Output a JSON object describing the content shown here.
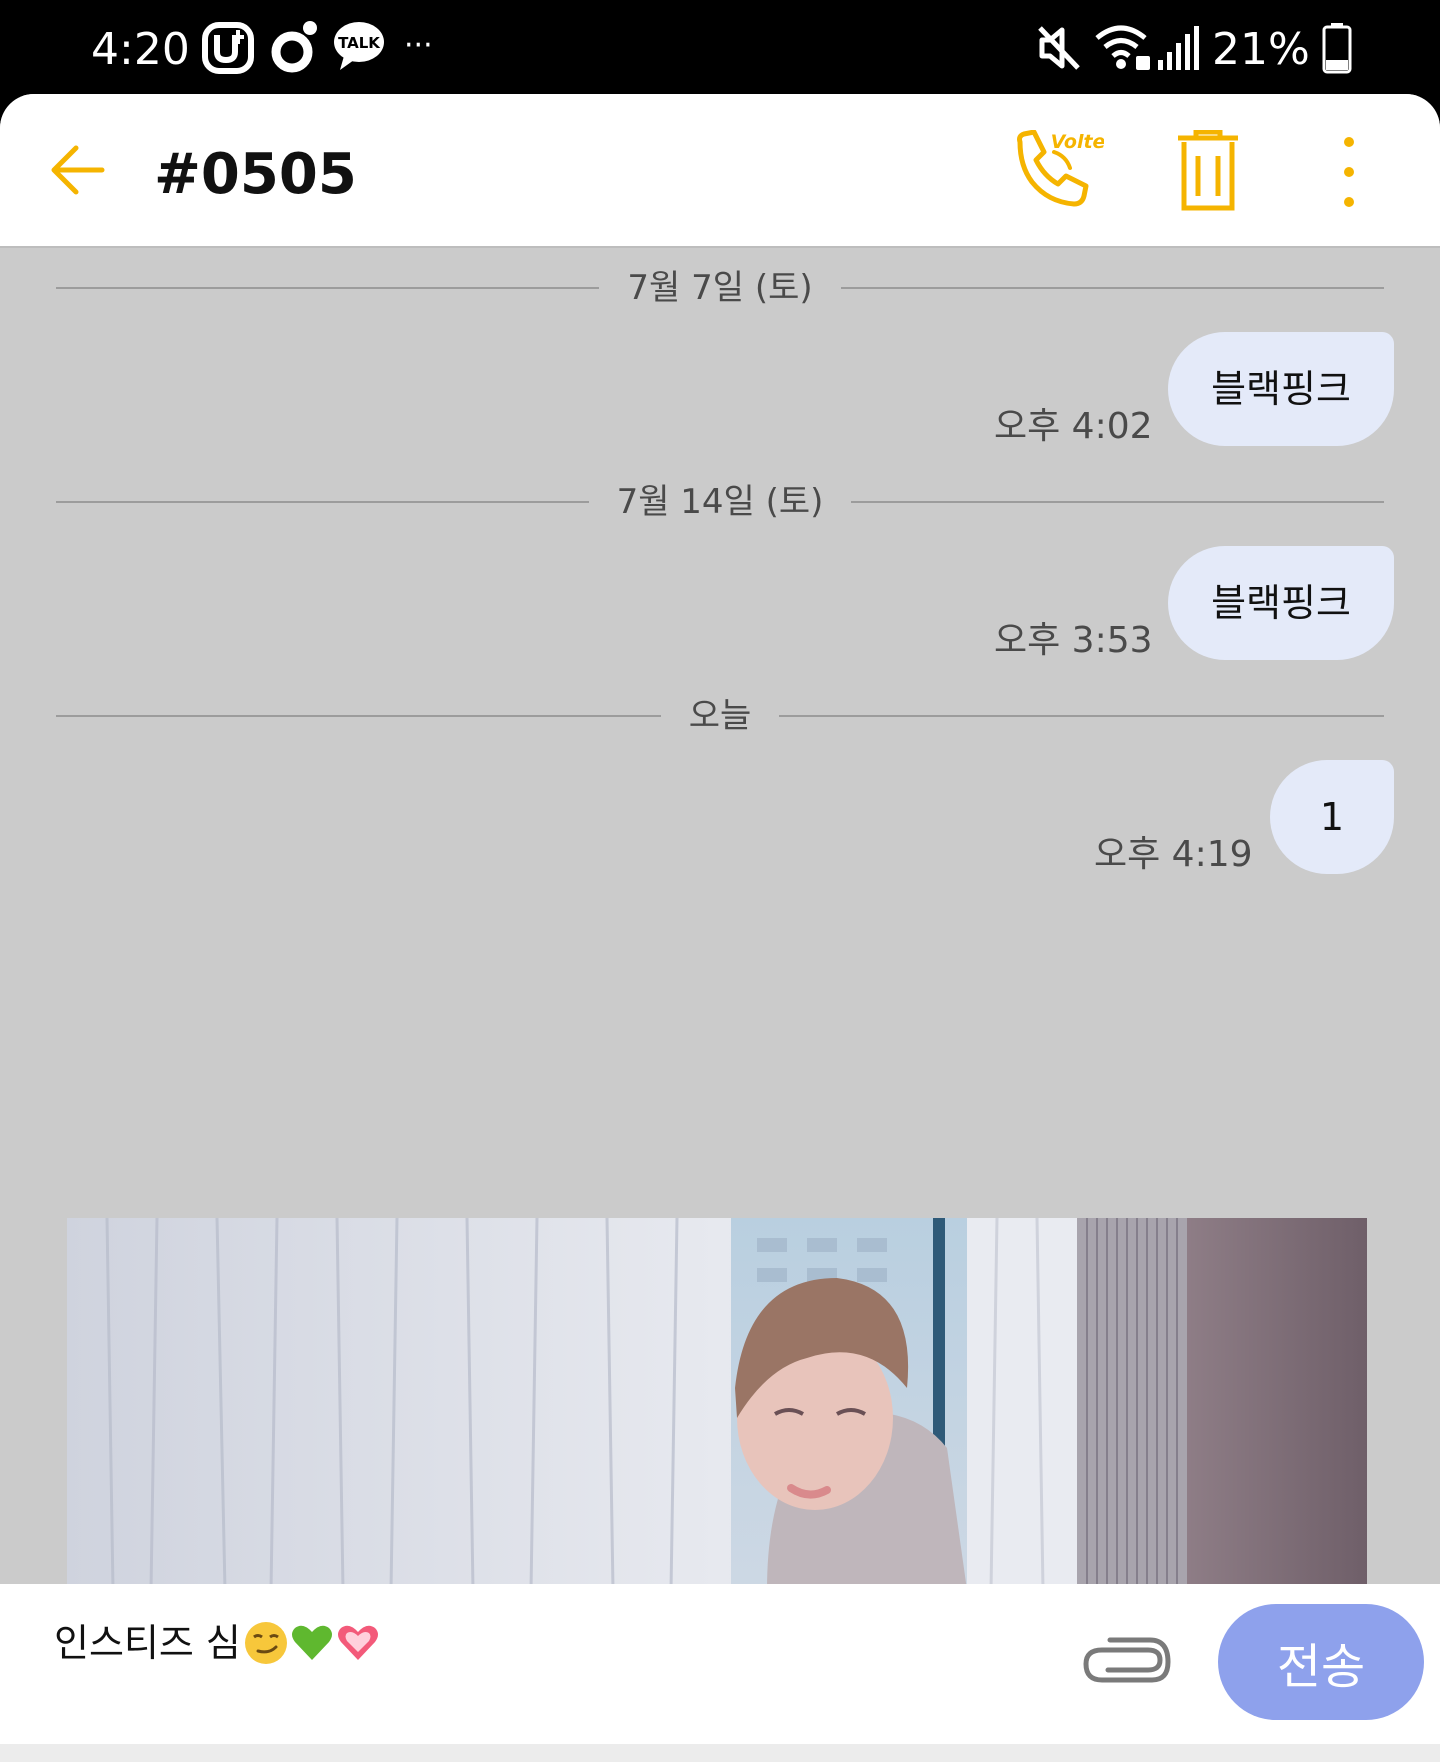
{
  "status_bar": {
    "time": "4:20",
    "battery_percent": "21%",
    "more_label": "···",
    "talk_label": "TALK",
    "icons": [
      "u-plus-icon",
      "notification-dot-icon",
      "talk-icon",
      "mute-icon",
      "wifi-icon",
      "signal-icon",
      "battery-icon"
    ]
  },
  "header": {
    "title": "#0505",
    "volte_label": "Volte",
    "icons": [
      "back-arrow-icon",
      "volte-call-icon",
      "trash-icon",
      "more-vert-icon"
    ],
    "accent_color": "#f5b400"
  },
  "conversation": {
    "dividers": [
      "7월 7일 (토)",
      "7월 14일 (토)",
      "오늘"
    ],
    "messages": [
      {
        "text": "블랙핑크",
        "time": "오후 4:02"
      },
      {
        "text": "블랙핑크",
        "time": "오후 3:53"
      },
      {
        "text": "1",
        "time": "오후 4:19"
      }
    ],
    "bubble_color": "#e4eaf9"
  },
  "composer": {
    "input_value": "인스티즈 심",
    "emojis": [
      "smirk-emoji",
      "green-heart-emoji",
      "sparkling-heart-emoji"
    ],
    "send_label": "전송",
    "send_color": "#8ea1ec"
  }
}
